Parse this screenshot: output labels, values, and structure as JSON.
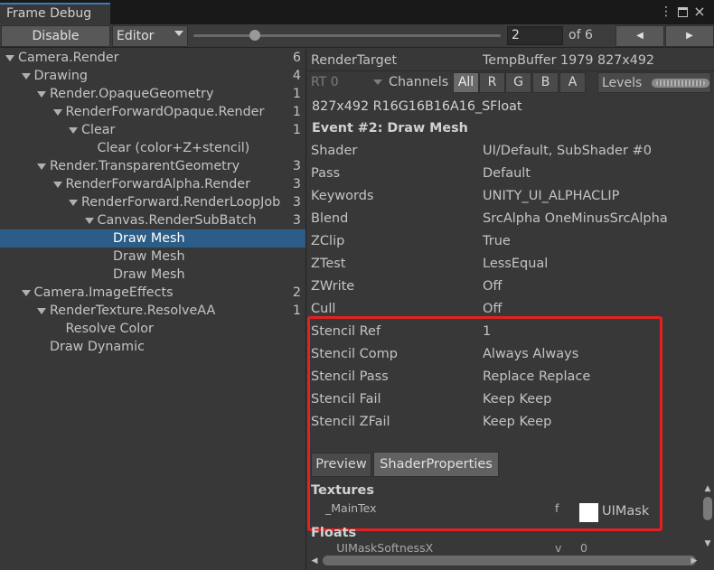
{
  "window": {
    "tab_title": "Frame Debug"
  },
  "toolbar": {
    "disable_label": "Disable",
    "editor_label": "Editor",
    "slider_fraction": 0.2,
    "event_index": "2",
    "of_label": "of 6",
    "prev_label": "◀",
    "next_label": "▶"
  },
  "tree": [
    {
      "label": "Camera.Render",
      "count": "6",
      "expanded": true,
      "depth": 0
    },
    {
      "label": "Drawing",
      "count": "4",
      "expanded": true,
      "depth": 1
    },
    {
      "label": "Render.OpaqueGeometry",
      "count": "1",
      "expanded": true,
      "depth": 2
    },
    {
      "label": "RenderForwardOpaque.Render",
      "count": "1",
      "expanded": true,
      "depth": 3
    },
    {
      "label": "Clear",
      "count": "1",
      "expanded": true,
      "depth": 4
    },
    {
      "label": "Clear (color+Z+stencil)",
      "count": "",
      "expanded": null,
      "depth": 5
    },
    {
      "label": "Render.TransparentGeometry",
      "count": "3",
      "expanded": true,
      "depth": 2
    },
    {
      "label": "RenderForwardAlpha.Render",
      "count": "3",
      "expanded": true,
      "depth": 3
    },
    {
      "label": "RenderForward.RenderLoopJob",
      "count": "3",
      "expanded": true,
      "depth": 4
    },
    {
      "label": "Canvas.RenderSubBatch",
      "count": "3",
      "expanded": true,
      "depth": 5
    },
    {
      "label": "Draw Mesh",
      "count": "",
      "expanded": null,
      "depth": 6,
      "selected": true
    },
    {
      "label": "Draw Mesh",
      "count": "",
      "expanded": null,
      "depth": 6
    },
    {
      "label": "Draw Mesh",
      "count": "",
      "expanded": null,
      "depth": 6
    },
    {
      "label": "Camera.ImageEffects",
      "count": "2",
      "expanded": true,
      "depth": 1
    },
    {
      "label": "RenderTexture.ResolveAA",
      "count": "1",
      "expanded": true,
      "depth": 2
    },
    {
      "label": "Resolve Color",
      "count": "",
      "expanded": null,
      "depth": 3
    },
    {
      "label": "Draw Dynamic",
      "count": "",
      "expanded": null,
      "depth": 2
    }
  ],
  "render_target": {
    "label": "RenderTarget",
    "value": "TempBuffer 1979 827x492"
  },
  "rt_select": "RT 0",
  "channels": {
    "label": "Channels",
    "buttons": [
      "All",
      "R",
      "G",
      "B",
      "A"
    ],
    "active": "All"
  },
  "levels_label": "Levels",
  "format_text": "827x492 R16G16B16A16_SFloat",
  "event_title": "Event #2: Draw Mesh",
  "properties": [
    {
      "key": "Shader",
      "value": "UI/Default, SubShader #0"
    },
    {
      "key": "Pass",
      "value": "Default"
    },
    {
      "key": "Keywords",
      "value": "UNITY_UI_ALPHACLIP"
    },
    {
      "key": "Blend",
      "value": "SrcAlpha OneMinusSrcAlpha"
    },
    {
      "key": "ZClip",
      "value": "True"
    },
    {
      "key": "ZTest",
      "value": "LessEqual"
    },
    {
      "key": "ZWrite",
      "value": "Off"
    },
    {
      "key": "Cull",
      "value": "Off"
    },
    {
      "key": "Stencil Ref",
      "value": "1"
    },
    {
      "key": "Stencil Comp",
      "value": "Always Always"
    },
    {
      "key": "Stencil Pass",
      "value": "Replace Replace"
    },
    {
      "key": "Stencil Fail",
      "value": "Keep Keep"
    },
    {
      "key": "Stencil ZFail",
      "value": "Keep Keep"
    }
  ],
  "tabs": {
    "preview": "Preview",
    "shader_properties": "ShaderProperties"
  },
  "textures": {
    "heading": "Textures",
    "name": "_MainTex",
    "stage": "f",
    "texture": "UIMask"
  },
  "floats": {
    "heading": "Floats",
    "name": "_UIMaskSoftnessX",
    "stage": "v",
    "value": "0"
  },
  "colors": {
    "accent": "#3a79bb",
    "selection": "#2c5d87",
    "highlight": "#e32121"
  }
}
